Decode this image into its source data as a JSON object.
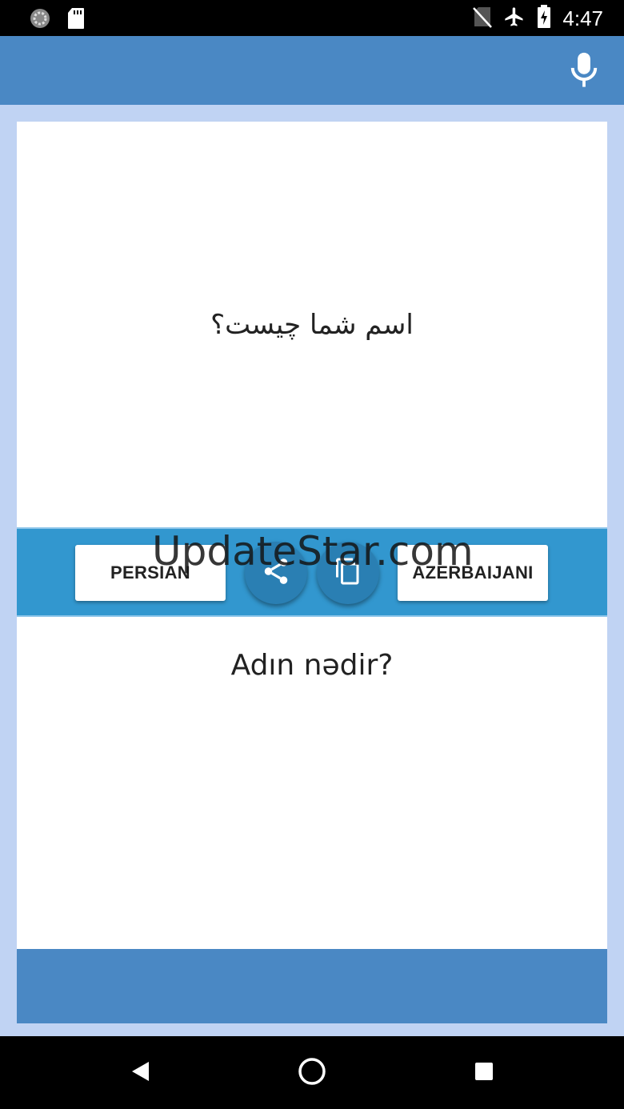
{
  "status_bar": {
    "time": "4:47",
    "left_icons": [
      "loading-icon",
      "sd-card-icon"
    ],
    "right_icons": [
      "no-sim-icon",
      "airplane-mode-icon",
      "battery-charging-icon"
    ]
  },
  "app_bar": {
    "color": "#4a88c4",
    "mic_icon": "microphone-icon"
  },
  "source": {
    "text": "اسم شما چیست؟"
  },
  "languages": {
    "source_label": "PERSIAN",
    "target_label": "AZERBAIJANI",
    "share_icon": "share-icon",
    "copy_icon": "copy-icon",
    "bar_color": "#3297cf"
  },
  "target": {
    "text": "Adın nədir?"
  },
  "watermark": {
    "text": "UpdateStar.com"
  },
  "nav_bar": {
    "icons": [
      "back-icon",
      "home-icon",
      "recents-icon"
    ]
  }
}
